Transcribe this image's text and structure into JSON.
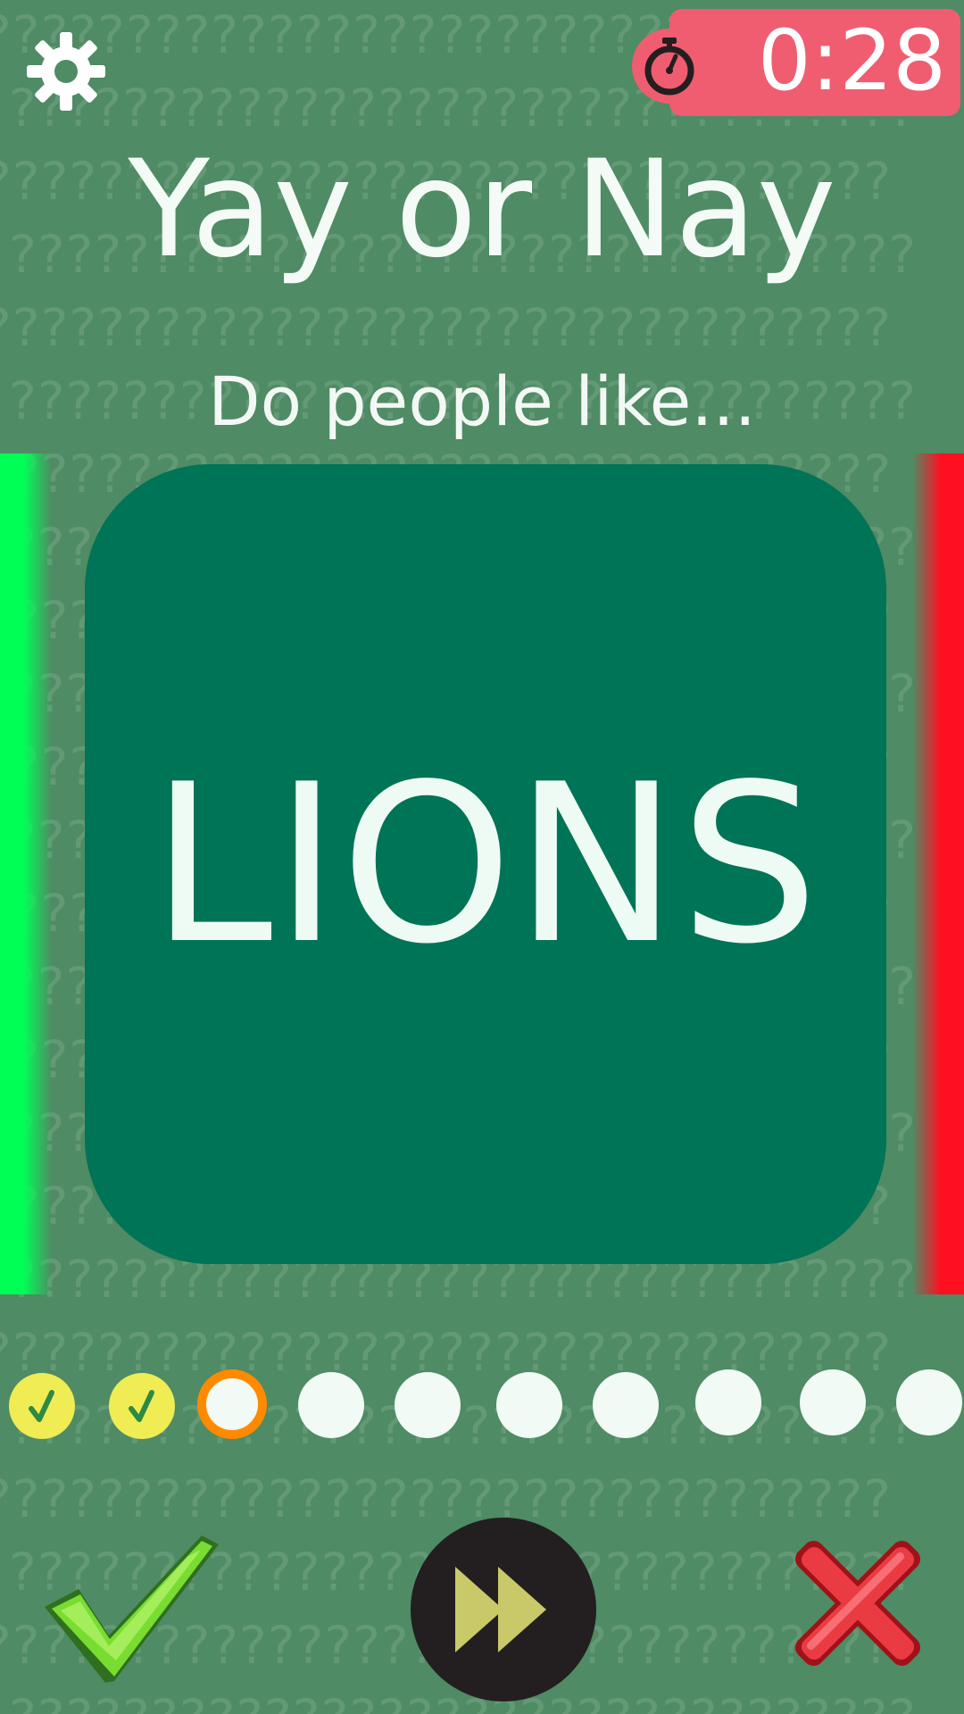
{
  "timer": {
    "value": "0:28",
    "icon": "stopwatch-icon"
  },
  "header": {
    "title": "Yay or Nay",
    "subtitle": "Do people like..."
  },
  "card": {
    "word": "LIONS"
  },
  "progress": {
    "total": 10,
    "completed": 2,
    "current": 3
  },
  "controls": {
    "yay_icon": "checkmark-icon",
    "skip_icon": "fast-forward-icon",
    "nay_icon": "cross-icon"
  },
  "colors": {
    "background": "#4f8b64",
    "timer": "#f05d70",
    "card": "#007456",
    "yay": "#00ff55",
    "nay": "#ff1020",
    "progress_done": "#f0ec54",
    "progress_current": "#ff8a00"
  }
}
